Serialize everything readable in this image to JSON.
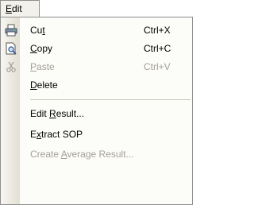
{
  "menu": {
    "title_prefix": "",
    "title_accel": "E",
    "title_rest": "dit"
  },
  "items": [
    {
      "pre": "Cu",
      "accel": "t",
      "post": "",
      "shortcut": "Ctrl+X",
      "icon": "printer-icon",
      "disabled": false
    },
    {
      "pre": "",
      "accel": "C",
      "post": "opy",
      "shortcut": "Ctrl+C",
      "icon": "print-preview-icon",
      "disabled": false
    },
    {
      "pre": "",
      "accel": "P",
      "post": "aste",
      "shortcut": "Ctrl+V",
      "icon": "scissors-icon",
      "disabled": true
    },
    {
      "pre": "",
      "accel": "D",
      "post": "elete",
      "shortcut": "",
      "icon": "",
      "disabled": false
    },
    {
      "pre": "Edit ",
      "accel": "R",
      "post": "esult...",
      "shortcut": "",
      "icon": "",
      "disabled": false
    },
    {
      "pre": "E",
      "accel": "x",
      "post": "tract SOP",
      "shortcut": "",
      "icon": "",
      "disabled": false
    },
    {
      "pre": "Create ",
      "accel": "A",
      "post": "verage Result...",
      "shortcut": "",
      "icon": "",
      "disabled": true
    }
  ]
}
